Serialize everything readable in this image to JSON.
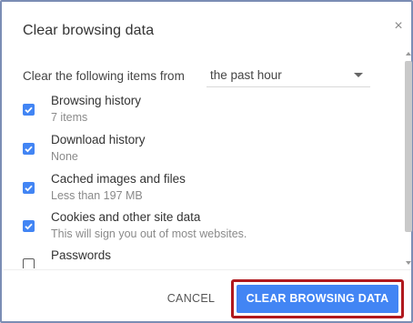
{
  "dialog": {
    "title": "Clear browsing data",
    "close_symbol": "×"
  },
  "time_range": {
    "label": "Clear the following items from",
    "selected": "the past hour"
  },
  "items": [
    {
      "label": "Browsing history",
      "detail": "7 items",
      "checked": true
    },
    {
      "label": "Download history",
      "detail": "None",
      "checked": true
    },
    {
      "label": "Cached images and files",
      "detail": "Less than 197 MB",
      "checked": true
    },
    {
      "label": "Cookies and other site data",
      "detail": "This will sign you out of most websites.",
      "checked": true
    },
    {
      "label": "Passwords",
      "detail": "",
      "checked": false
    }
  ],
  "buttons": {
    "cancel": "CANCEL",
    "clear": "CLEAR BROWSING DATA"
  },
  "colors": {
    "accent": "#4285f4",
    "highlight": "#b0191e"
  }
}
